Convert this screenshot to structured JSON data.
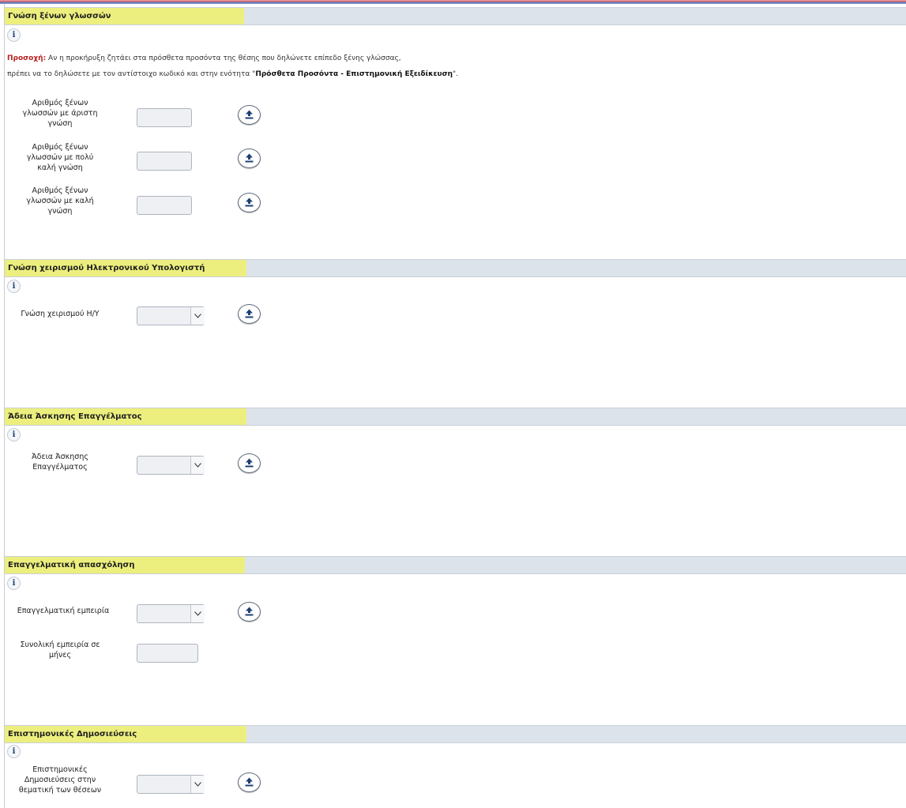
{
  "sections": {
    "languages": {
      "title": "Γνώση ξένων γλωσσών",
      "info_icon": "i",
      "notice": {
        "prefix": "Προσοχή:",
        "line1": " Αν η προκήρυξη ζητάει στα πρόσθετα προσόντα της θέσης που δηλώνετε επίπεδο ξένης γλώσσας,",
        "line2_start": "πρέπει να το δηλώσετε με τον αντίστοιχο κωδικό και στην ενότητα \"",
        "line2_bold": "Πρόσθετα Προσόντα - Επιστημονική Εξειδίκευση",
        "line2_end": "\"."
      },
      "fields": [
        {
          "label": "Αριθμός ξένων γλωσσών με άριστη γνώση",
          "value": ""
        },
        {
          "label": "Αριθμός ξένων γλωσσών με πολύ καλή γνώση",
          "value": ""
        },
        {
          "label": "Αριθμός ξένων γλωσσών με καλή γνώση",
          "value": ""
        }
      ]
    },
    "computer": {
      "title": "Γνώση χειρισμού Ηλεκτρονικού Υπολογιστή",
      "info_icon": "i",
      "fields": [
        {
          "label": "Γνώση χειρισμού Η/Υ",
          "value": ""
        }
      ]
    },
    "license": {
      "title": "Άδεια Άσκησης Επαγγέλματος",
      "info_icon": "i",
      "fields": [
        {
          "label": "Άδεια Άσκησης Επαγγέλματος",
          "value": ""
        }
      ]
    },
    "employment": {
      "title": "Επαγγελματική απασχόληση",
      "info_icon": "i",
      "fields": [
        {
          "label": "Επαγγελματική εμπειρία",
          "value": ""
        },
        {
          "label": "Συνολική εμπειρία σε μήνες",
          "value": ""
        }
      ]
    },
    "publications": {
      "title": "Επιστημονικές Δημοσιεύσεις",
      "info_icon": "i",
      "fields": [
        {
          "label": "Επιστημονικές Δημοσιεύσεις στην θεματική των θέσεων",
          "value": ""
        }
      ]
    }
  },
  "icons": {
    "info": "info-icon",
    "upload": "upload-icon",
    "dropdown": "chevron-down-icon"
  },
  "colors": {
    "title_highlight": "#ecef7e",
    "header_bar": "#dde3eb",
    "warning_text": "#b81f1f",
    "icon_blue": "#1d3f73"
  }
}
